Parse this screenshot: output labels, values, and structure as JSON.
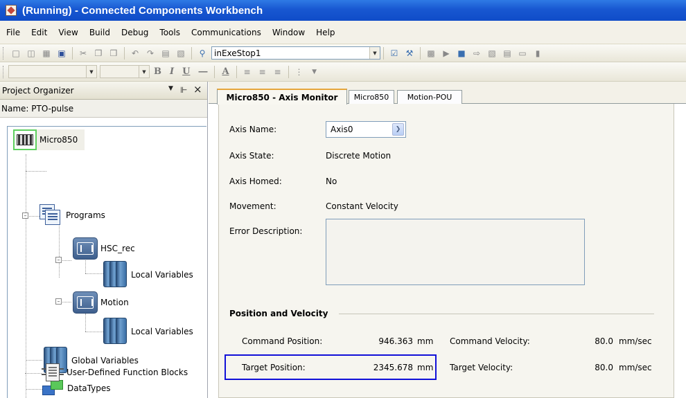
{
  "window": {
    "title": "(Running) - Connected Components Workbench"
  },
  "menu": [
    "File",
    "Edit",
    "View",
    "Build",
    "Debug",
    "Tools",
    "Communications",
    "Window",
    "Help"
  ],
  "toolbar": {
    "config_combo_value": "inExeStop1"
  },
  "organizer": {
    "title": "Project Organizer",
    "pin_glyph": "\u0004",
    "close_glyph": "×",
    "name_line": "Name:  PTO-pulse",
    "tree": {
      "controller": "Micro850",
      "programs": "Programs",
      "program1": "HSC_rec",
      "program1_vars": "Local Variables",
      "program2": "Motion",
      "program2_vars": "Local Variables",
      "global_vars": "Global Variables",
      "datatypes": "DataTypes",
      "udfb": "User-Defined Function Blocks"
    }
  },
  "tabs": [
    "Micro850 - Axis Monitor",
    "Micro850",
    "Motion-POU"
  ],
  "axis": {
    "name_label": "Axis Name:",
    "name_value": "Axis0",
    "state_label": "Axis State:",
    "state_value": "Discrete Motion",
    "homed_label": "Axis Homed:",
    "homed_value": "No",
    "movement_label": "Movement:",
    "movement_value": "Constant Velocity",
    "error_label": "Error Description:",
    "error_value": ""
  },
  "pv": {
    "section_title": "Position and Velocity",
    "cmd_pos_label": "Command Position:",
    "cmd_pos_value": "946.363",
    "cmd_pos_unit": "mm",
    "cmd_vel_label": "Command Velocity:",
    "cmd_vel_value": "80.0",
    "cmd_vel_unit": "mm/sec",
    "tgt_pos_label": "Target Position:",
    "tgt_pos_value": "2345.678",
    "tgt_pos_unit": "mm",
    "tgt_vel_label": "Target Velocity:",
    "tgt_vel_value": "80.0",
    "tgt_vel_unit": "mm/sec"
  },
  "colors": {
    "titlebar": "#1857d1",
    "active_tab_accent": "#e6a53a",
    "highlight_box": "#1010d8",
    "plc_icon_border": "#5ed05e"
  }
}
